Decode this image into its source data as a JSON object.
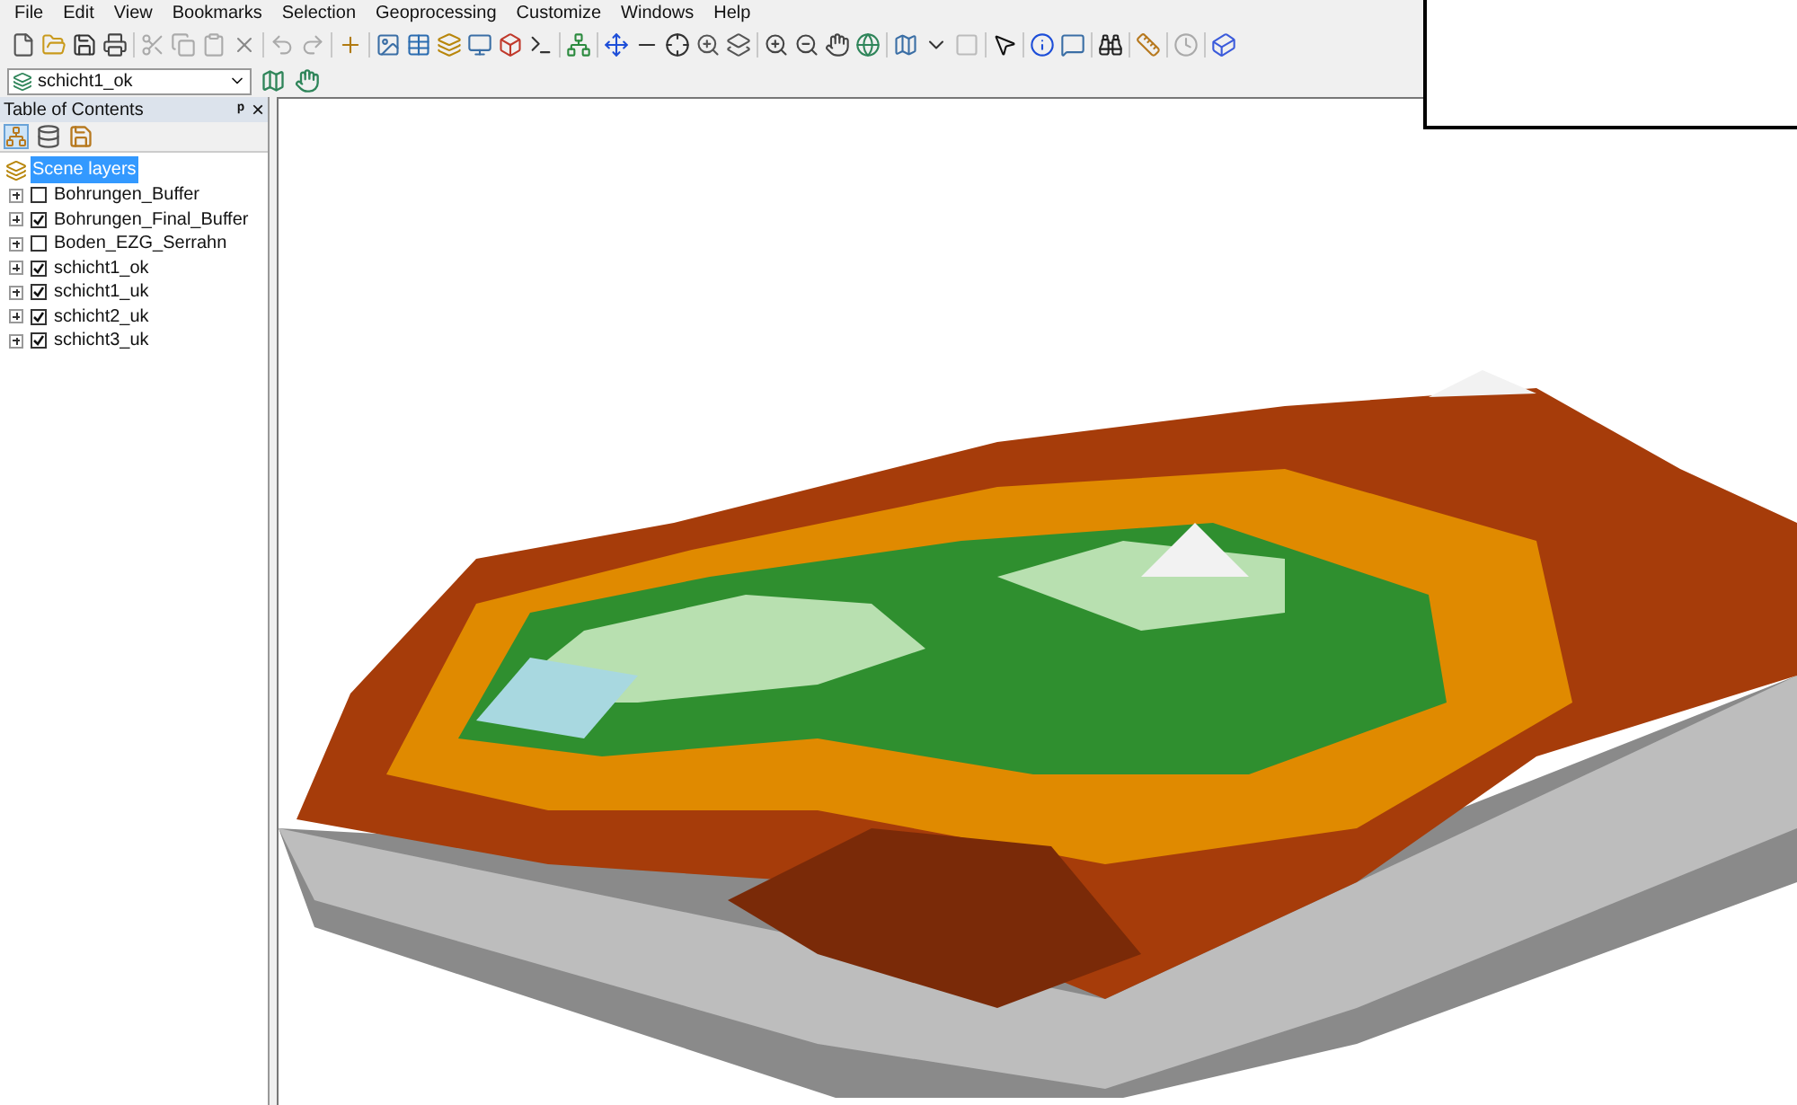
{
  "menu_bar": [
    "File",
    "Edit",
    "View",
    "Bookmarks",
    "Selection",
    "Geoprocessing",
    "Customize",
    "Windows",
    "Help"
  ],
  "layer_dropdown": {
    "value": "schicht1_ok"
  },
  "table_of_contents": {
    "title": "Table of Contents",
    "pin": "ᵖ",
    "close": "×",
    "root": {
      "label": "Scene layers",
      "selected": true
    },
    "layers": [
      {
        "label": "Bohrungen_Buffer",
        "checked": false,
        "expanded": false
      },
      {
        "label": "Bohrungen_Final_Buffer",
        "checked": true,
        "expanded": false
      },
      {
        "label": "Boden_EZG_Serrahn",
        "checked": false,
        "expanded": false
      },
      {
        "label": "schicht1_ok",
        "checked": true,
        "expanded": false
      },
      {
        "label": "schicht1_uk",
        "checked": true,
        "expanded": false
      },
      {
        "label": "schicht2_uk",
        "checked": true,
        "expanded": false
      },
      {
        "label": "schicht3_uk",
        "checked": true,
        "expanded": false
      }
    ]
  }
}
